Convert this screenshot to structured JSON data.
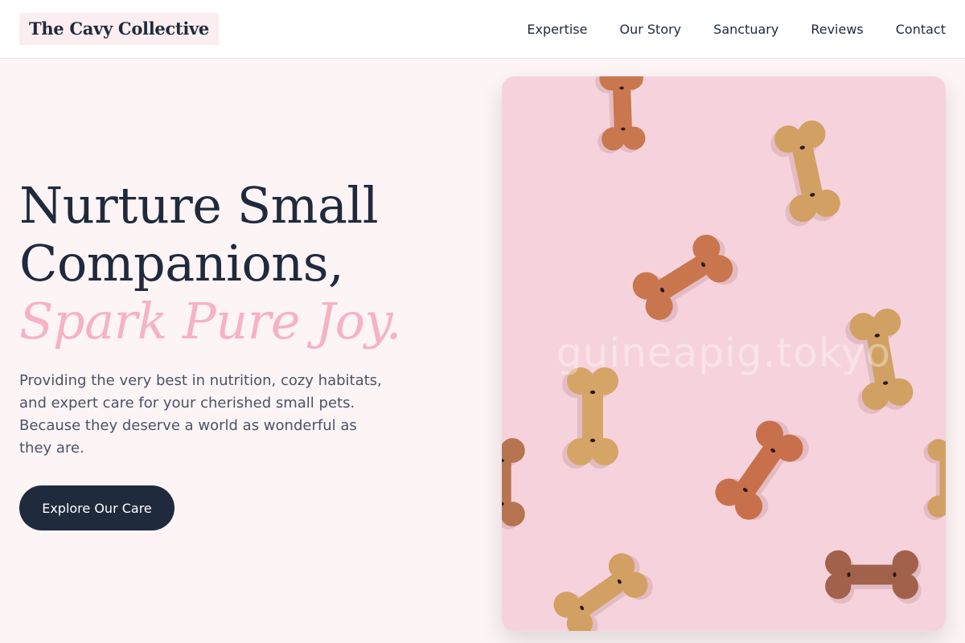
{
  "header": {
    "logo": "The Cavy Collective",
    "nav": [
      "Expertise",
      "Our Story",
      "Sanctuary",
      "Reviews",
      "Contact"
    ]
  },
  "hero": {
    "title_line1": "Nurture Small",
    "title_line2": "Companions,",
    "title_accent": "Spark Pure Joy.",
    "description": "Providing the very best in nutrition, cozy habitats, and expert care for your cherished small pets. Because they deserve a world as wonderful as they are.",
    "cta_label": "Explore Our Care"
  },
  "image": {
    "subject": "bone-shaped dog treats on pink background",
    "watermark": "guineapig.tokyo"
  },
  "colors": {
    "navy": "#1f2a3d",
    "accent_pink": "#f5b3c4",
    "page_bg": "#fdf4f5"
  }
}
